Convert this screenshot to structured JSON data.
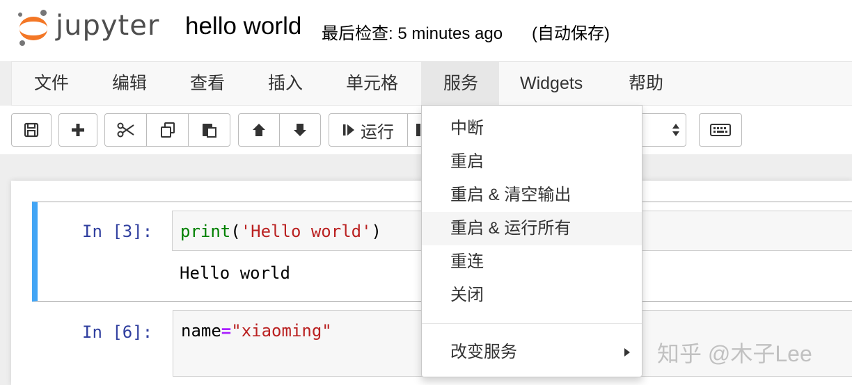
{
  "header": {
    "logo_text": "jupyter",
    "notebook_title": "hello world",
    "checkpoint": "最后检查: 5 minutes ago",
    "autosave": "(自动保存)"
  },
  "menubar": {
    "items": [
      "文件",
      "编辑",
      "查看",
      "插入",
      "单元格",
      "服务",
      "Widgets",
      "帮助"
    ],
    "open_item": "服务"
  },
  "toolbar": {
    "run_label": "运行"
  },
  "kernel_menu": {
    "items": [
      "中断",
      "重启",
      "重启 & 清空输出",
      "重启 & 运行所有",
      "重连",
      "关闭"
    ],
    "hovered": "重启 & 运行所有",
    "submenu_item": "改变服务"
  },
  "cells": [
    {
      "prompt": "In [3]:",
      "code_fn": "print",
      "code_open": "(",
      "code_str": "'Hello world'",
      "code_close": ")",
      "output": "Hello world"
    },
    {
      "prompt": "In [6]:",
      "code_name": "name",
      "code_op": "=",
      "code_str": "\"xiaoming\""
    }
  ],
  "watermark": "知乎 @木子Lee",
  "colors": {
    "accent_orange": "#f37726",
    "selected_cell_border": "#42a5f5",
    "prompt_blue": "#303f9f",
    "string_red": "#ba2121",
    "builtin_green": "#008000",
    "operator_purple": "#aa22ff"
  },
  "icons": [
    "save-icon",
    "plus-icon",
    "scissors-icon",
    "copy-icon",
    "paste-icon",
    "arrow-up-icon",
    "arrow-down-icon",
    "step-forward-icon",
    "keyboard-icon",
    "select-arrows-icon",
    "caret-right-icon"
  ]
}
